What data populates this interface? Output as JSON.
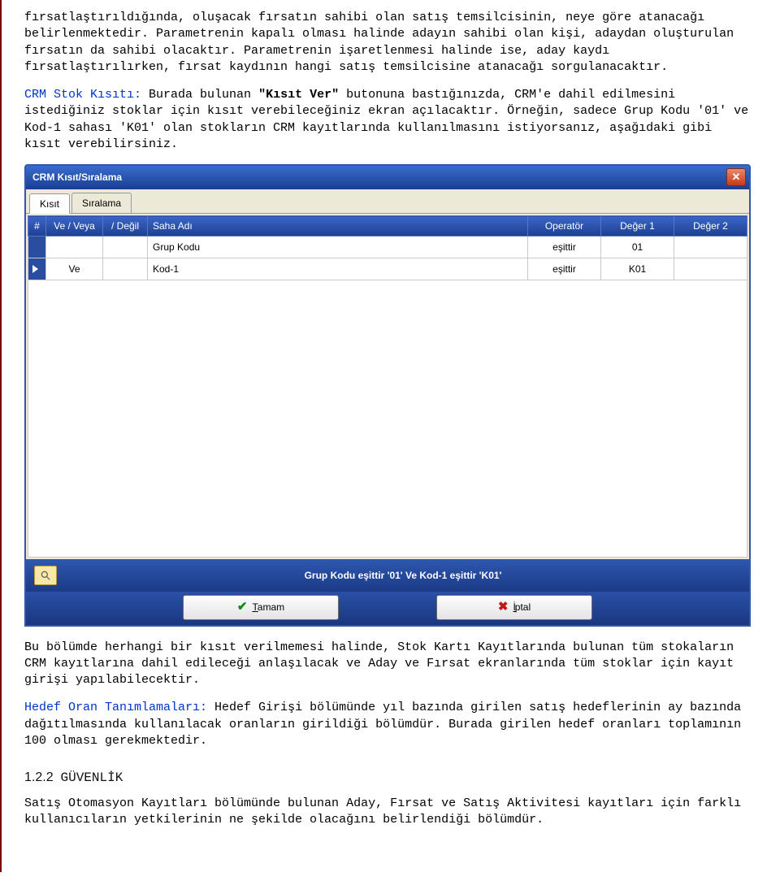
{
  "doc": {
    "p1": "fırsatlaştırıldığında, oluşacak fırsatın sahibi olan satış temsilcisinin, neye göre atanacağı belirlenmektedir. Parametrenin kapalı olması halinde adayın sahibi olan kişi, adaydan oluşturulan fırsatın da sahibi olacaktır. Parametrenin işaretlenmesi halinde ise, aday kaydı fırsatlaştırılırken, fırsat kaydının hangi satış temsilcisine atanacağı sorgulanacaktır.",
    "crm_label": "CRM Stok Kısıtı:",
    "crm_text_a": " Burada bulunan ",
    "crm_bold": "\"Kısıt Ver\"",
    "crm_text_b": " butonuna bastığınızda, CRM'e dahil edilmesini istediğiniz stoklar için kısıt verebileceğiniz ekran açılacaktır. Örneğin, sadece Grup Kodu '01' ve Kod-1 sahası 'K01' olan stokların CRM kayıtlarında kullanılmasını istiyorsanız, aşağıdaki gibi kısıt verebilirsiniz.",
    "p3": "Bu bölümde herhangi bir kısıt verilmemesi halinde, Stok Kartı Kayıtlarında bulunan tüm stokaların CRM kayıtlarına dahil edileceği anlaşılacak ve Aday ve Fırsat ekranlarında tüm stoklar için kayıt girişi yapılabilecektir.",
    "hedef_label": "Hedef Oran Tanımlamaları:",
    "hedef_text": " Hedef Girişi bölümünde yıl bazında girilen satış hedeflerinin ay bazında dağıtılmasında kullanılacak oranların girildiği bölümdür. Burada girilen hedef oranları toplamının 100 olması gerekmektedir.",
    "section_num": "1.2.2",
    "section_title": "GÜVENLİK",
    "p5": "Satış Otomasyon Kayıtları bölümünde bulunan Aday, Fırsat ve Satış Aktivitesi kayıtları için farklı kullanıcıların yetkilerinin ne şekilde olacağını belirlendiği bölümdür."
  },
  "win": {
    "title": "CRM Kısıt/Sıralama",
    "tabs": {
      "t1": "Kısıt",
      "t2": "Sıralama"
    },
    "headers": {
      "num": "#",
      "veveya": "Ve / Veya",
      "degil": "/ Değil",
      "saha": "Saha Adı",
      "op": "Operatör",
      "d1": "Değer 1",
      "d2": "Değer 2"
    },
    "rows": [
      {
        "veveya": "",
        "degil": "",
        "saha": "Grup Kodu",
        "op": "eşittir",
        "d1": "01",
        "d2": ""
      },
      {
        "veveya": "Ve",
        "degil": "",
        "saha": "Kod-1",
        "op": "eşittir",
        "d1": "K01",
        "d2": ""
      }
    ],
    "status": "Grup Kodu  eşittir '01' Ve Kod-1  eşittir 'K01'",
    "buttons": {
      "ok": "Tamam",
      "cancel": "İptal"
    }
  }
}
